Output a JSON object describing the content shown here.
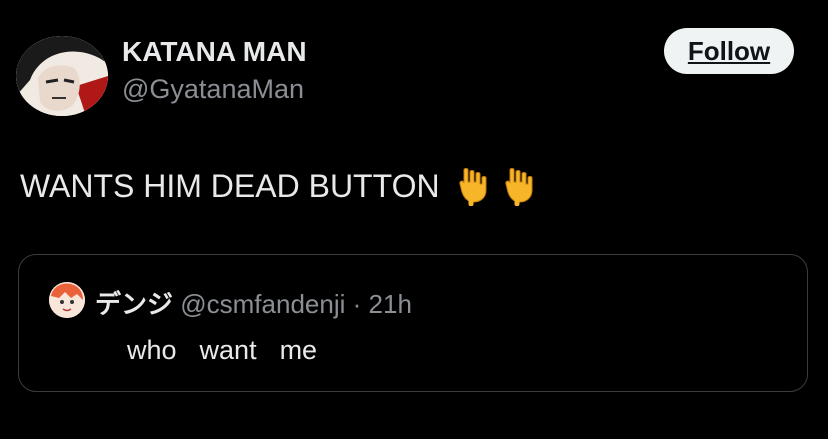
{
  "author": {
    "display_name": "KATANA MAN",
    "handle": "@GyatanaMan"
  },
  "follow_button": {
    "label": "Follow"
  },
  "tweet": {
    "text": "WANTS HIM DEAD BUTTON",
    "emojis": [
      "pointing-down-emoji",
      "pointing-down-emoji"
    ]
  },
  "quoted_tweet": {
    "display_name": "デンジ",
    "handle": "@csmfandenji",
    "separator": "·",
    "time": "21h",
    "text": "who  want  me"
  },
  "colors": {
    "background": "#000000",
    "primary_text": "#e7e9ea",
    "secondary_text": "#8b8f94",
    "follow_button_bg": "#eff3f4",
    "card_border": "#3a3d40"
  }
}
